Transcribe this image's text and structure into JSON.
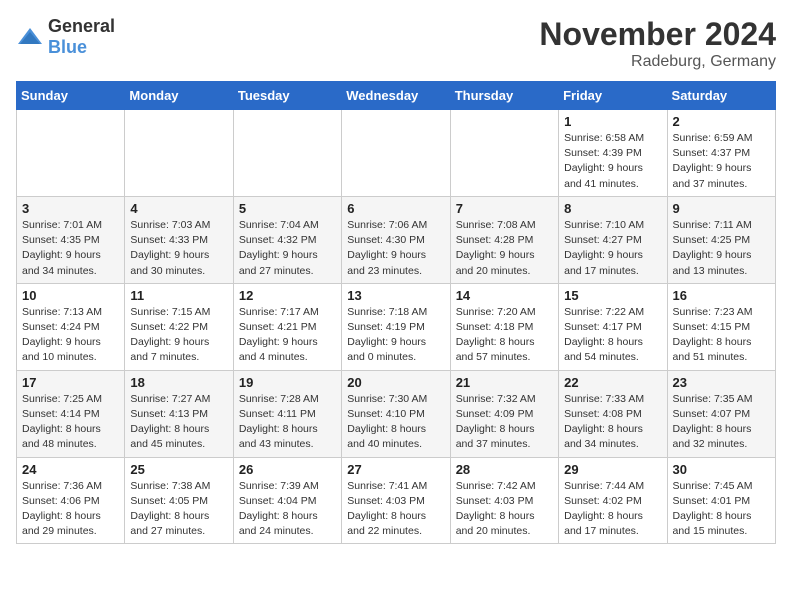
{
  "header": {
    "logo_general": "General",
    "logo_blue": "Blue",
    "month": "November 2024",
    "location": "Radeburg, Germany"
  },
  "weekdays": [
    "Sunday",
    "Monday",
    "Tuesday",
    "Wednesday",
    "Thursday",
    "Friday",
    "Saturday"
  ],
  "weeks": [
    [
      {
        "day": "",
        "info": ""
      },
      {
        "day": "",
        "info": ""
      },
      {
        "day": "",
        "info": ""
      },
      {
        "day": "",
        "info": ""
      },
      {
        "day": "",
        "info": ""
      },
      {
        "day": "1",
        "info": "Sunrise: 6:58 AM\nSunset: 4:39 PM\nDaylight: 9 hours\nand 41 minutes."
      },
      {
        "day": "2",
        "info": "Sunrise: 6:59 AM\nSunset: 4:37 PM\nDaylight: 9 hours\nand 37 minutes."
      }
    ],
    [
      {
        "day": "3",
        "info": "Sunrise: 7:01 AM\nSunset: 4:35 PM\nDaylight: 9 hours\nand 34 minutes."
      },
      {
        "day": "4",
        "info": "Sunrise: 7:03 AM\nSunset: 4:33 PM\nDaylight: 9 hours\nand 30 minutes."
      },
      {
        "day": "5",
        "info": "Sunrise: 7:04 AM\nSunset: 4:32 PM\nDaylight: 9 hours\nand 27 minutes."
      },
      {
        "day": "6",
        "info": "Sunrise: 7:06 AM\nSunset: 4:30 PM\nDaylight: 9 hours\nand 23 minutes."
      },
      {
        "day": "7",
        "info": "Sunrise: 7:08 AM\nSunset: 4:28 PM\nDaylight: 9 hours\nand 20 minutes."
      },
      {
        "day": "8",
        "info": "Sunrise: 7:10 AM\nSunset: 4:27 PM\nDaylight: 9 hours\nand 17 minutes."
      },
      {
        "day": "9",
        "info": "Sunrise: 7:11 AM\nSunset: 4:25 PM\nDaylight: 9 hours\nand 13 minutes."
      }
    ],
    [
      {
        "day": "10",
        "info": "Sunrise: 7:13 AM\nSunset: 4:24 PM\nDaylight: 9 hours\nand 10 minutes."
      },
      {
        "day": "11",
        "info": "Sunrise: 7:15 AM\nSunset: 4:22 PM\nDaylight: 9 hours\nand 7 minutes."
      },
      {
        "day": "12",
        "info": "Sunrise: 7:17 AM\nSunset: 4:21 PM\nDaylight: 9 hours\nand 4 minutes."
      },
      {
        "day": "13",
        "info": "Sunrise: 7:18 AM\nSunset: 4:19 PM\nDaylight: 9 hours\nand 0 minutes."
      },
      {
        "day": "14",
        "info": "Sunrise: 7:20 AM\nSunset: 4:18 PM\nDaylight: 8 hours\nand 57 minutes."
      },
      {
        "day": "15",
        "info": "Sunrise: 7:22 AM\nSunset: 4:17 PM\nDaylight: 8 hours\nand 54 minutes."
      },
      {
        "day": "16",
        "info": "Sunrise: 7:23 AM\nSunset: 4:15 PM\nDaylight: 8 hours\nand 51 minutes."
      }
    ],
    [
      {
        "day": "17",
        "info": "Sunrise: 7:25 AM\nSunset: 4:14 PM\nDaylight: 8 hours\nand 48 minutes."
      },
      {
        "day": "18",
        "info": "Sunrise: 7:27 AM\nSunset: 4:13 PM\nDaylight: 8 hours\nand 45 minutes."
      },
      {
        "day": "19",
        "info": "Sunrise: 7:28 AM\nSunset: 4:11 PM\nDaylight: 8 hours\nand 43 minutes."
      },
      {
        "day": "20",
        "info": "Sunrise: 7:30 AM\nSunset: 4:10 PM\nDaylight: 8 hours\nand 40 minutes."
      },
      {
        "day": "21",
        "info": "Sunrise: 7:32 AM\nSunset: 4:09 PM\nDaylight: 8 hours\nand 37 minutes."
      },
      {
        "day": "22",
        "info": "Sunrise: 7:33 AM\nSunset: 4:08 PM\nDaylight: 8 hours\nand 34 minutes."
      },
      {
        "day": "23",
        "info": "Sunrise: 7:35 AM\nSunset: 4:07 PM\nDaylight: 8 hours\nand 32 minutes."
      }
    ],
    [
      {
        "day": "24",
        "info": "Sunrise: 7:36 AM\nSunset: 4:06 PM\nDaylight: 8 hours\nand 29 minutes."
      },
      {
        "day": "25",
        "info": "Sunrise: 7:38 AM\nSunset: 4:05 PM\nDaylight: 8 hours\nand 27 minutes."
      },
      {
        "day": "26",
        "info": "Sunrise: 7:39 AM\nSunset: 4:04 PM\nDaylight: 8 hours\nand 24 minutes."
      },
      {
        "day": "27",
        "info": "Sunrise: 7:41 AM\nSunset: 4:03 PM\nDaylight: 8 hours\nand 22 minutes."
      },
      {
        "day": "28",
        "info": "Sunrise: 7:42 AM\nSunset: 4:03 PM\nDaylight: 8 hours\nand 20 minutes."
      },
      {
        "day": "29",
        "info": "Sunrise: 7:44 AM\nSunset: 4:02 PM\nDaylight: 8 hours\nand 17 minutes."
      },
      {
        "day": "30",
        "info": "Sunrise: 7:45 AM\nSunset: 4:01 PM\nDaylight: 8 hours\nand 15 minutes."
      }
    ]
  ]
}
